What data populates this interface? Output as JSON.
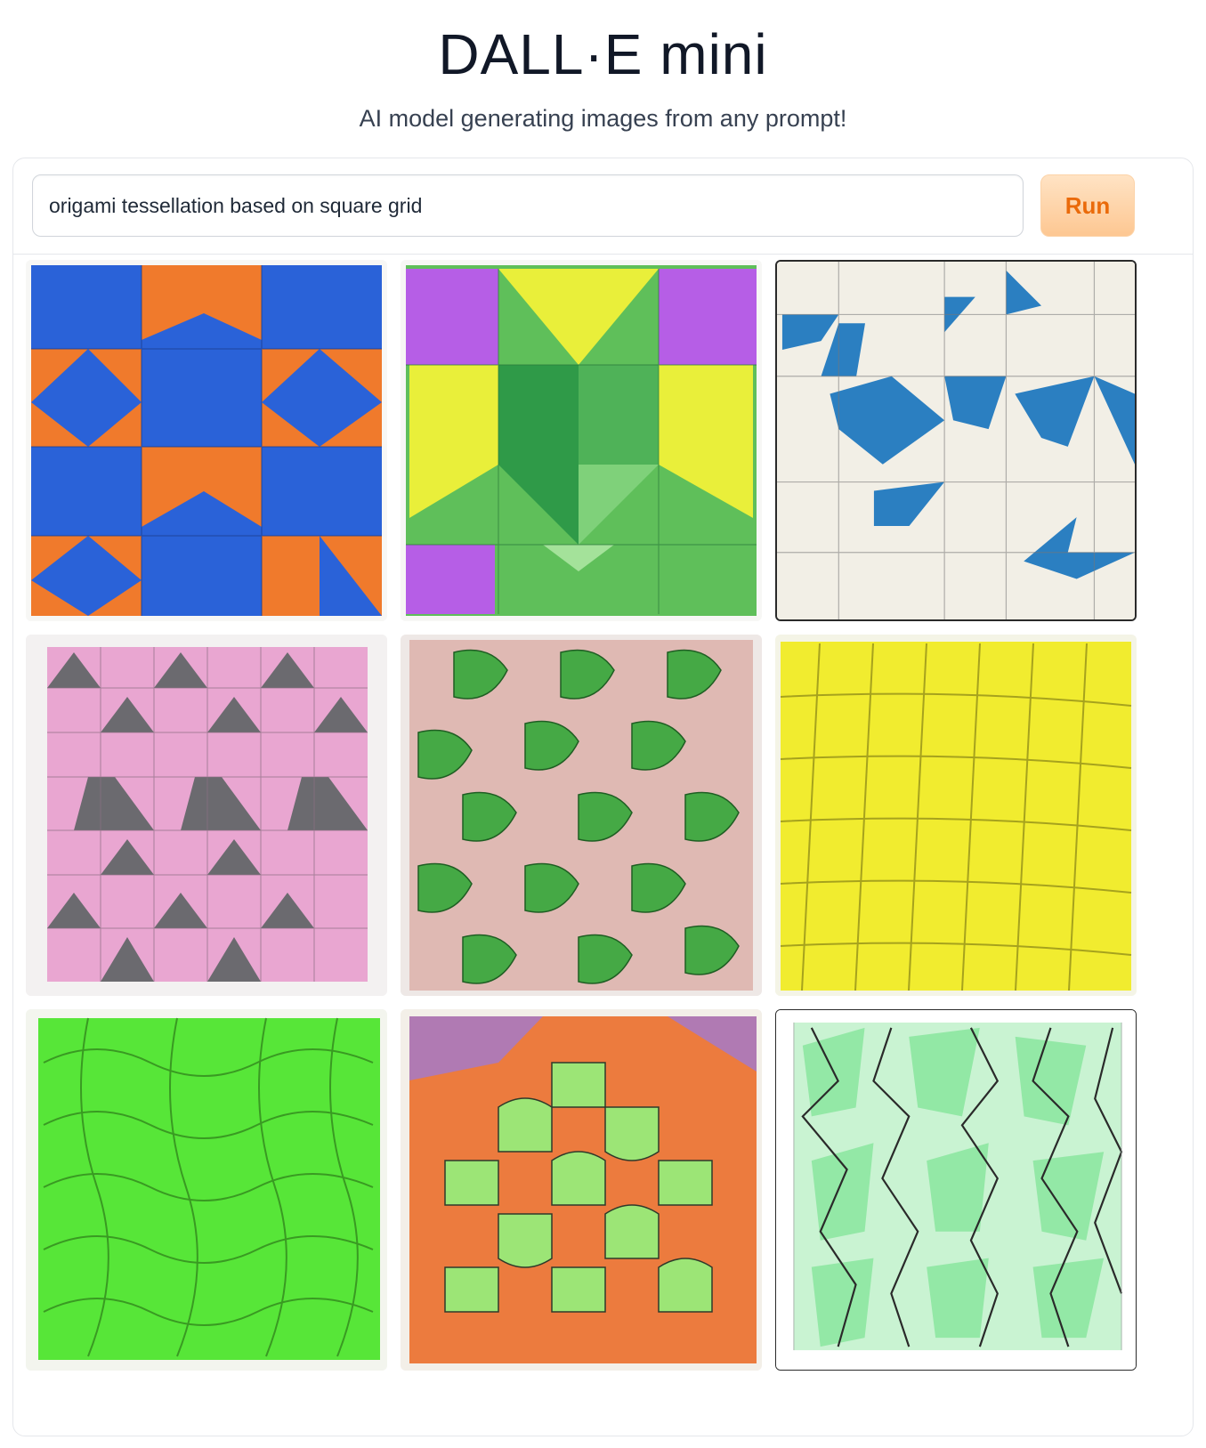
{
  "app": {
    "title": "DALL·E mini",
    "subtitle": "AI model generating images from any prompt!"
  },
  "prompt": {
    "value": "origami tessellation based on square grid"
  },
  "run_button": {
    "label": "Run"
  },
  "gallery": {
    "images": [
      {
        "name": "generated-image-1",
        "palette": [
          "#2a62d8",
          "#f07a2c"
        ]
      },
      {
        "name": "generated-image-2",
        "palette": [
          "#b65ee6",
          "#e9ef3a",
          "#5fbf5a",
          "#2f9a48"
        ]
      },
      {
        "name": "generated-image-3",
        "palette": [
          "#f2efe6",
          "#2b7fc1"
        ]
      },
      {
        "name": "generated-image-4",
        "palette": [
          "#e9a6d1",
          "#6b6a6f"
        ]
      },
      {
        "name": "generated-image-5",
        "palette": [
          "#45a945",
          "#d9aaa2"
        ]
      },
      {
        "name": "generated-image-6",
        "palette": [
          "#f1ec2f",
          "#d8d620"
        ]
      },
      {
        "name": "generated-image-7",
        "palette": [
          "#57e638",
          "#3fbf26"
        ]
      },
      {
        "name": "generated-image-8",
        "palette": [
          "#ec7b3e",
          "#9ce576",
          "#b07ab3"
        ]
      },
      {
        "name": "generated-image-9",
        "palette": [
          "#ffffff",
          "#8de7a1",
          "#2a2a2a"
        ]
      }
    ]
  }
}
